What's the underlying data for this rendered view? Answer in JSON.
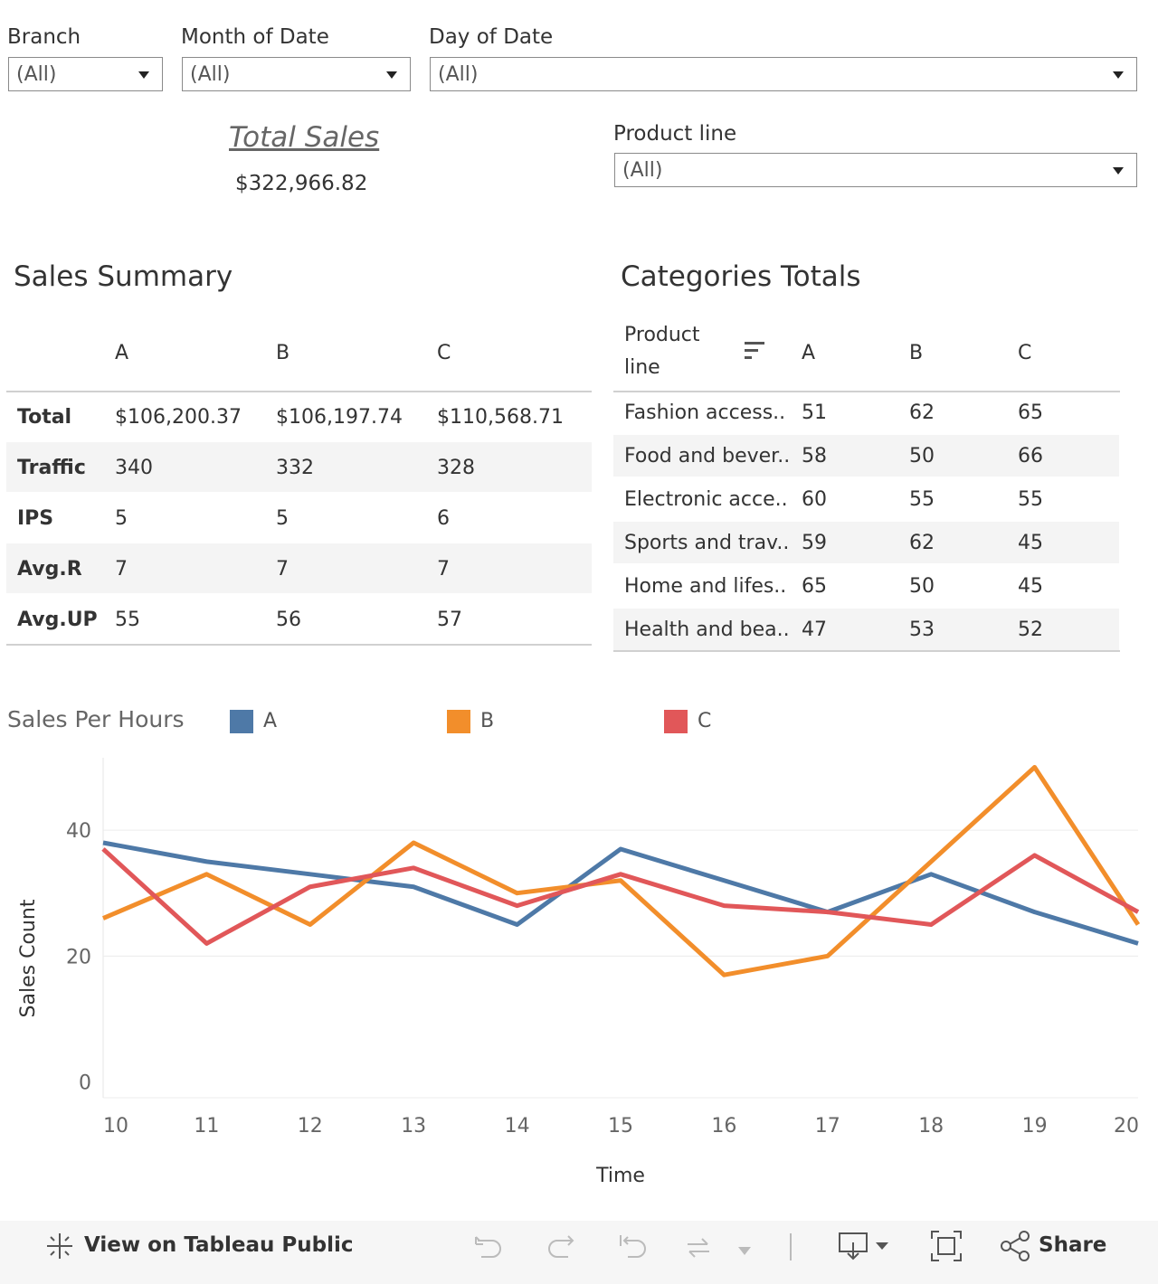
{
  "filters": {
    "branch": {
      "label": "Branch",
      "value": "(All)"
    },
    "month": {
      "label": "Month of Date",
      "value": "(All)"
    },
    "day": {
      "label": "Day of Date",
      "value": "(All)"
    },
    "product_line": {
      "label": "Product line",
      "value": "(All)"
    }
  },
  "total_sales": {
    "title": "Total Sales",
    "value": "$322,966.82"
  },
  "sales_summary": {
    "title": "Sales Summary",
    "columns": [
      "A",
      "B",
      "C"
    ],
    "rows": [
      {
        "label": "Total",
        "values": [
          "$106,200.37",
          "$106,197.74",
          "$110,568.71"
        ]
      },
      {
        "label": "Traffic",
        "values": [
          "340",
          "332",
          "328"
        ]
      },
      {
        "label": "IPS",
        "values": [
          "5",
          "5",
          "6"
        ]
      },
      {
        "label": "Avg.R",
        "values": [
          "7",
          "7",
          "7"
        ]
      },
      {
        "label": "Avg.UP",
        "values": [
          "55",
          "56",
          "57"
        ]
      }
    ]
  },
  "categories_totals": {
    "title": "Categories Totals",
    "header_line1": "Product",
    "header_line2": "line",
    "sort_icon": "sort-icon",
    "columns": [
      "A",
      "B",
      "C"
    ],
    "rows": [
      {
        "label": "Fashion access..",
        "values": [
          "51",
          "62",
          "65"
        ]
      },
      {
        "label": "Food and bever..",
        "values": [
          "58",
          "50",
          "66"
        ]
      },
      {
        "label": "Electronic acce..",
        "values": [
          "60",
          "55",
          "55"
        ]
      },
      {
        "label": "Sports and trav..",
        "values": [
          "59",
          "62",
          "45"
        ]
      },
      {
        "label": "Home and lifes..",
        "values": [
          "65",
          "50",
          "45"
        ]
      },
      {
        "label": "Health and bea..",
        "values": [
          "47",
          "53",
          "52"
        ]
      }
    ]
  },
  "chart_data": {
    "type": "line",
    "title": "Sales Per Hours",
    "xlabel": "Time",
    "ylabel": "Sales Count",
    "x": [
      10,
      11,
      12,
      13,
      14,
      15,
      16,
      17,
      18,
      19,
      20
    ],
    "xlim": [
      10,
      20
    ],
    "ylim": [
      -2.5,
      51.5
    ],
    "yticks": [
      0,
      20,
      40
    ],
    "grid": true,
    "legend_position": "top",
    "series": [
      {
        "name": "A",
        "color": "#4e79a7",
        "values": [
          38,
          35,
          33,
          31,
          25,
          37,
          32,
          27,
          33,
          27,
          22
        ]
      },
      {
        "name": "B",
        "color": "#f28e2b",
        "values": [
          26,
          33,
          25,
          38,
          30,
          32,
          17,
          20,
          35,
          50,
          25
        ]
      },
      {
        "name": "C",
        "color": "#e15759",
        "values": [
          37,
          22,
          31,
          34,
          28,
          33,
          28,
          27,
          25,
          36,
          27
        ]
      }
    ]
  },
  "footer": {
    "view_label": "View on Tableau Public",
    "share_label": "Share",
    "icons": [
      "tableau-logo-icon",
      "undo-icon",
      "redo-icon",
      "revert-icon",
      "refresh-icon",
      "download-icon",
      "fullscreen-icon",
      "share-icon"
    ]
  }
}
